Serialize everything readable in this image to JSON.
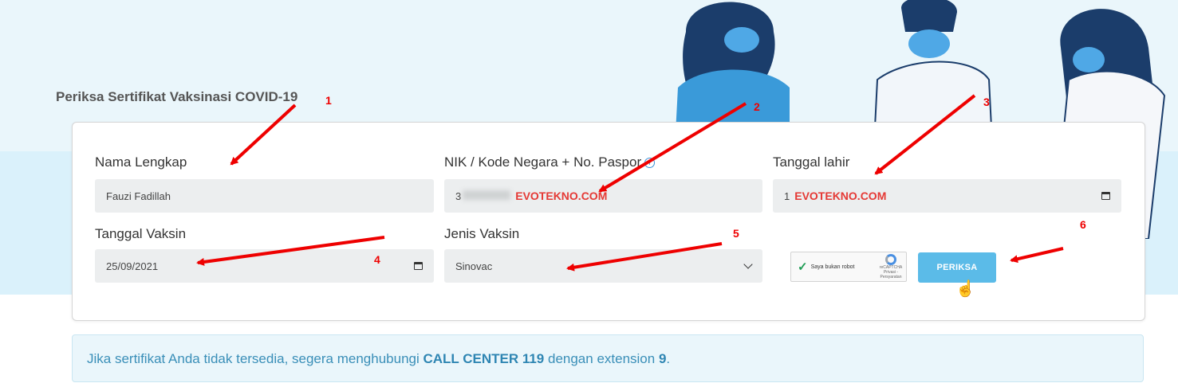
{
  "page": {
    "title": "Periksa Sertifikat Vaksinasi COVID-19"
  },
  "form": {
    "nama": {
      "label": "Nama Lengkap",
      "value": "Fauzi Fadillah"
    },
    "nik": {
      "label": "NIK / Kode Negara + No. Paspor",
      "value_prefix": "3",
      "watermark": "EVOTEKNO.COM"
    },
    "tgl_lahir": {
      "label": "Tanggal lahir",
      "value_prefix": "1",
      "watermark": "EVOTEKNO.COM"
    },
    "tgl_vaksin": {
      "label": "Tanggal Vaksin",
      "value": "25/09/2021"
    },
    "jenis_vaksin": {
      "label": "Jenis Vaksin",
      "value": "Sinovac"
    },
    "captcha": {
      "label": "Saya bukan robot",
      "brand": "reCAPTCHA",
      "sub": "Privasi - Persyaratan"
    },
    "submit_label": "PERIKSA"
  },
  "notice": {
    "prefix": "Jika sertifikat Anda tidak tersedia, segera menghubungi ",
    "call_center": "CALL CENTER 119",
    "middle": " dengan extension ",
    "extension": "9",
    "suffix": "."
  },
  "annotations": [
    "1",
    "2",
    "3",
    "4",
    "5",
    "6"
  ],
  "colors": {
    "accent": "#5bbbe8",
    "annotation": "#e00000",
    "hero": "#daf1fb"
  }
}
